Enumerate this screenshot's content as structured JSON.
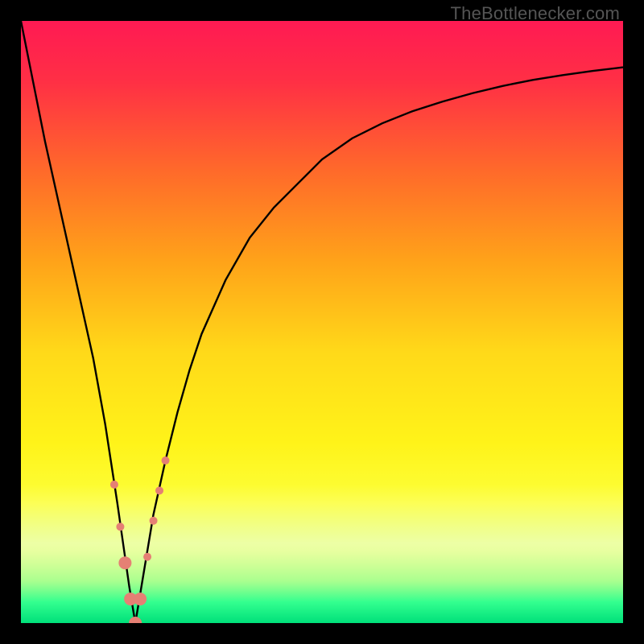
{
  "watermark": "TheBottlenecker.com",
  "chart_data": {
    "type": "line",
    "title": "",
    "xlabel": "",
    "ylabel": "",
    "xlim": [
      0,
      100
    ],
    "ylim": [
      0,
      100
    ],
    "x_zero_crossing": 19,
    "series": [
      {
        "name": "bottleneck-curve",
        "x": [
          0,
          2,
          4,
          6,
          8,
          10,
          12,
          14,
          16,
          17,
          18,
          19,
          20,
          21,
          22,
          24,
          26,
          28,
          30,
          34,
          38,
          42,
          46,
          50,
          55,
          60,
          65,
          70,
          75,
          80,
          85,
          90,
          95,
          100
        ],
        "y": [
          100,
          90,
          80,
          71,
          62,
          53,
          44,
          33,
          20,
          13,
          6,
          0,
          6,
          12,
          18,
          27,
          35,
          42,
          48,
          57,
          64,
          69,
          73,
          77,
          80.5,
          83,
          85,
          86.6,
          88,
          89.2,
          90.2,
          91,
          91.7,
          92.3
        ]
      }
    ],
    "markers": {
      "name": "data-dots",
      "color": "#e58074",
      "close_radius": 8,
      "far_radius": 5,
      "points": [
        {
          "x": 15.5,
          "y": 23
        },
        {
          "x": 16.5,
          "y": 16
        },
        {
          "x": 17.3,
          "y": 10
        },
        {
          "x": 18.2,
          "y": 4
        },
        {
          "x": 19.0,
          "y": 0
        },
        {
          "x": 19.8,
          "y": 4
        },
        {
          "x": 21.0,
          "y": 11
        },
        {
          "x": 22.0,
          "y": 17
        },
        {
          "x": 23.0,
          "y": 22
        },
        {
          "x": 24.0,
          "y": 27
        }
      ]
    },
    "gradient_stops": [
      {
        "offset": 0.0,
        "color": "#ff1a53"
      },
      {
        "offset": 0.1,
        "color": "#ff2f45"
      },
      {
        "offset": 0.25,
        "color": "#ff6a2a"
      },
      {
        "offset": 0.4,
        "color": "#ffa319"
      },
      {
        "offset": 0.55,
        "color": "#ffd919"
      },
      {
        "offset": 0.7,
        "color": "#fff319"
      },
      {
        "offset": 0.8,
        "color": "#fcff3a"
      },
      {
        "offset": 0.88,
        "color": "#d9ff63"
      },
      {
        "offset": 0.93,
        "color": "#99ff7a"
      },
      {
        "offset": 0.965,
        "color": "#33ff8f"
      },
      {
        "offset": 1.0,
        "color": "#00e07a"
      }
    ],
    "pale_band": {
      "top_frac": 0.77,
      "bottom_frac": 0.965
    }
  }
}
